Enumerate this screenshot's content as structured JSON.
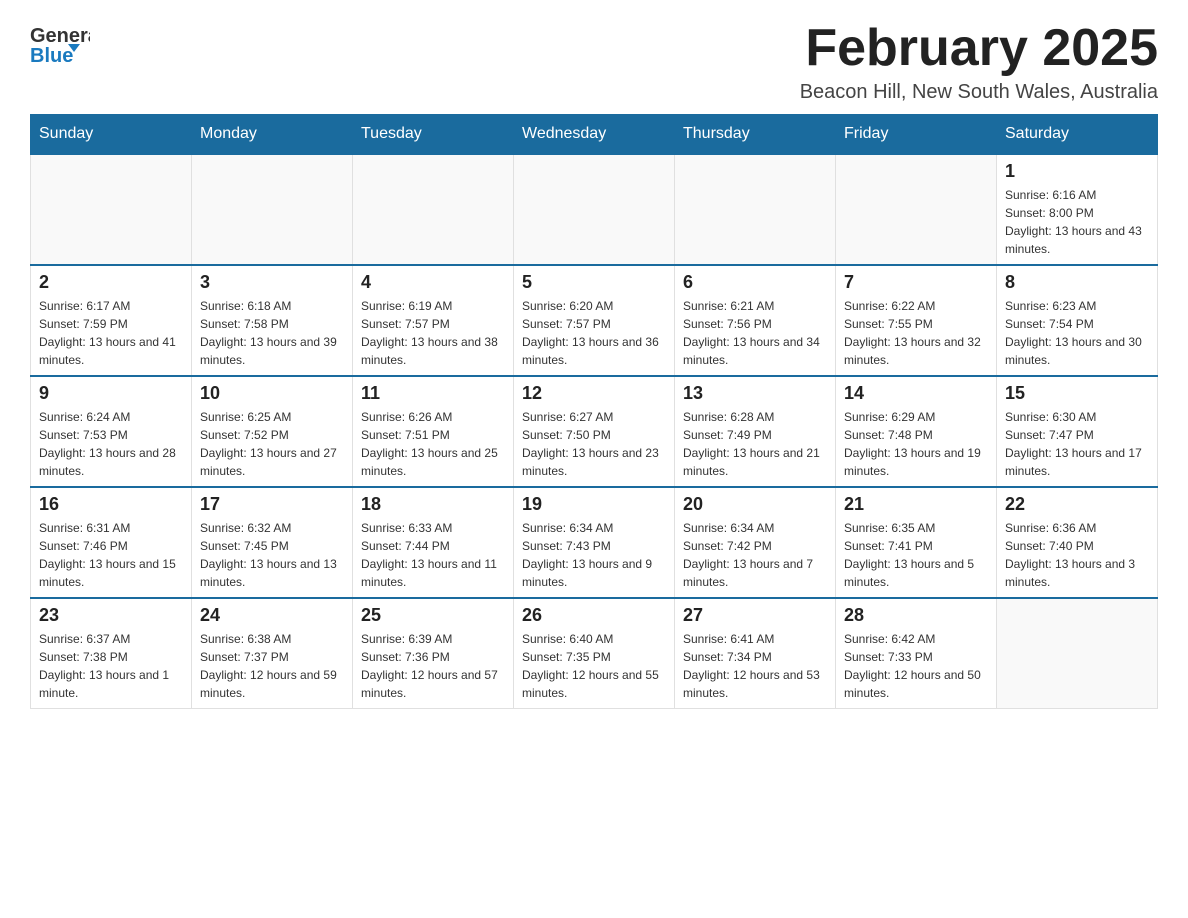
{
  "header": {
    "logo_general": "General",
    "logo_blue": "Blue",
    "month_title": "February 2025",
    "location": "Beacon Hill, New South Wales, Australia"
  },
  "days_of_week": [
    "Sunday",
    "Monday",
    "Tuesday",
    "Wednesday",
    "Thursday",
    "Friday",
    "Saturday"
  ],
  "weeks": [
    [
      {
        "day": "",
        "info": ""
      },
      {
        "day": "",
        "info": ""
      },
      {
        "day": "",
        "info": ""
      },
      {
        "day": "",
        "info": ""
      },
      {
        "day": "",
        "info": ""
      },
      {
        "day": "",
        "info": ""
      },
      {
        "day": "1",
        "info": "Sunrise: 6:16 AM\nSunset: 8:00 PM\nDaylight: 13 hours and 43 minutes."
      }
    ],
    [
      {
        "day": "2",
        "info": "Sunrise: 6:17 AM\nSunset: 7:59 PM\nDaylight: 13 hours and 41 minutes."
      },
      {
        "day": "3",
        "info": "Sunrise: 6:18 AM\nSunset: 7:58 PM\nDaylight: 13 hours and 39 minutes."
      },
      {
        "day": "4",
        "info": "Sunrise: 6:19 AM\nSunset: 7:57 PM\nDaylight: 13 hours and 38 minutes."
      },
      {
        "day": "5",
        "info": "Sunrise: 6:20 AM\nSunset: 7:57 PM\nDaylight: 13 hours and 36 minutes."
      },
      {
        "day": "6",
        "info": "Sunrise: 6:21 AM\nSunset: 7:56 PM\nDaylight: 13 hours and 34 minutes."
      },
      {
        "day": "7",
        "info": "Sunrise: 6:22 AM\nSunset: 7:55 PM\nDaylight: 13 hours and 32 minutes."
      },
      {
        "day": "8",
        "info": "Sunrise: 6:23 AM\nSunset: 7:54 PM\nDaylight: 13 hours and 30 minutes."
      }
    ],
    [
      {
        "day": "9",
        "info": "Sunrise: 6:24 AM\nSunset: 7:53 PM\nDaylight: 13 hours and 28 minutes."
      },
      {
        "day": "10",
        "info": "Sunrise: 6:25 AM\nSunset: 7:52 PM\nDaylight: 13 hours and 27 minutes."
      },
      {
        "day": "11",
        "info": "Sunrise: 6:26 AM\nSunset: 7:51 PM\nDaylight: 13 hours and 25 minutes."
      },
      {
        "day": "12",
        "info": "Sunrise: 6:27 AM\nSunset: 7:50 PM\nDaylight: 13 hours and 23 minutes."
      },
      {
        "day": "13",
        "info": "Sunrise: 6:28 AM\nSunset: 7:49 PM\nDaylight: 13 hours and 21 minutes."
      },
      {
        "day": "14",
        "info": "Sunrise: 6:29 AM\nSunset: 7:48 PM\nDaylight: 13 hours and 19 minutes."
      },
      {
        "day": "15",
        "info": "Sunrise: 6:30 AM\nSunset: 7:47 PM\nDaylight: 13 hours and 17 minutes."
      }
    ],
    [
      {
        "day": "16",
        "info": "Sunrise: 6:31 AM\nSunset: 7:46 PM\nDaylight: 13 hours and 15 minutes."
      },
      {
        "day": "17",
        "info": "Sunrise: 6:32 AM\nSunset: 7:45 PM\nDaylight: 13 hours and 13 minutes."
      },
      {
        "day": "18",
        "info": "Sunrise: 6:33 AM\nSunset: 7:44 PM\nDaylight: 13 hours and 11 minutes."
      },
      {
        "day": "19",
        "info": "Sunrise: 6:34 AM\nSunset: 7:43 PM\nDaylight: 13 hours and 9 minutes."
      },
      {
        "day": "20",
        "info": "Sunrise: 6:34 AM\nSunset: 7:42 PM\nDaylight: 13 hours and 7 minutes."
      },
      {
        "day": "21",
        "info": "Sunrise: 6:35 AM\nSunset: 7:41 PM\nDaylight: 13 hours and 5 minutes."
      },
      {
        "day": "22",
        "info": "Sunrise: 6:36 AM\nSunset: 7:40 PM\nDaylight: 13 hours and 3 minutes."
      }
    ],
    [
      {
        "day": "23",
        "info": "Sunrise: 6:37 AM\nSunset: 7:38 PM\nDaylight: 13 hours and 1 minute."
      },
      {
        "day": "24",
        "info": "Sunrise: 6:38 AM\nSunset: 7:37 PM\nDaylight: 12 hours and 59 minutes."
      },
      {
        "day": "25",
        "info": "Sunrise: 6:39 AM\nSunset: 7:36 PM\nDaylight: 12 hours and 57 minutes."
      },
      {
        "day": "26",
        "info": "Sunrise: 6:40 AM\nSunset: 7:35 PM\nDaylight: 12 hours and 55 minutes."
      },
      {
        "day": "27",
        "info": "Sunrise: 6:41 AM\nSunset: 7:34 PM\nDaylight: 12 hours and 53 minutes."
      },
      {
        "day": "28",
        "info": "Sunrise: 6:42 AM\nSunset: 7:33 PM\nDaylight: 12 hours and 50 minutes."
      },
      {
        "day": "",
        "info": ""
      }
    ]
  ]
}
